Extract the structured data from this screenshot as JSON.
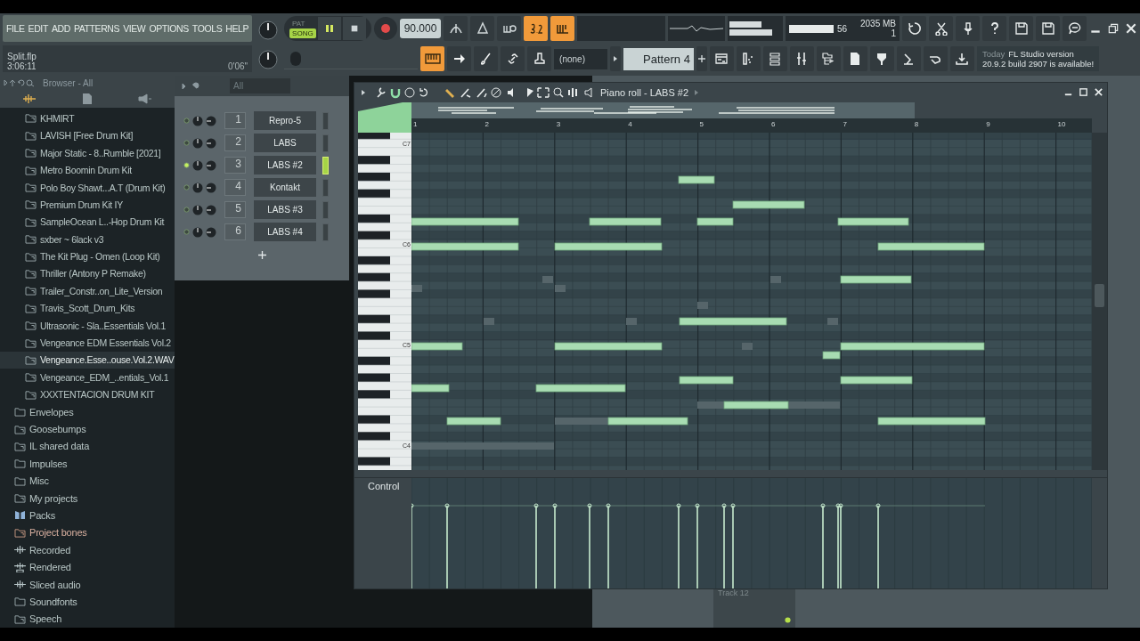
{
  "menu": [
    "FILE",
    "EDIT",
    "ADD",
    "PATTERNS",
    "VIEW",
    "OPTIONS",
    "TOOLS",
    "HELP"
  ],
  "project": {
    "file": "Split.flp",
    "time": "3:06:11",
    "elapsed": "0'06\""
  },
  "transport": {
    "modes": [
      {
        "label": "PAT",
        "selected": false
      },
      {
        "label": "SONG",
        "selected": true
      }
    ],
    "playing": true,
    "tempo": "90.000"
  },
  "toolbar_toggles": [
    {
      "kind": "metronome",
      "on": false
    },
    {
      "kind": "wait",
      "on": false
    },
    {
      "kind": "countdown",
      "on": true
    },
    {
      "kind": "loop",
      "on": true
    }
  ],
  "monitor": {
    "cpu": "56",
    "memory": "2035 MB",
    "voices": "1"
  },
  "typing_keyboard": {
    "on": true
  },
  "master_pitch": {
    "level": 0.05
  },
  "pattern": {
    "snap": "(none)",
    "name": "Pattern 4"
  },
  "news": {
    "date": "Today",
    "title": "FL Studio version",
    "text": "20.9.2 build 2907 is available!"
  },
  "browser": {
    "title": "Browser - All",
    "subfolder_items": [
      {
        "label": "KHMIRT",
        "kind": "linked",
        "selected": false
      },
      {
        "label": "LAVISH [Free Drum Kit]",
        "kind": "linked",
        "selected": false
      },
      {
        "label": "Major Static - 8..Rumble [2021]",
        "kind": "linked",
        "selected": false
      },
      {
        "label": "Metro Boomin Drum Kit",
        "kind": "linked",
        "selected": false
      },
      {
        "label": "Polo Boy Shawt...A.T (Drum Kit)",
        "kind": "linked",
        "selected": false
      },
      {
        "label": "Premium Drum Kit IY",
        "kind": "linked",
        "selected": false
      },
      {
        "label": "SampleOcean L..-Hop Drum Kit",
        "kind": "linked",
        "selected": false
      },
      {
        "label": "sxber ~ 6lack v3",
        "kind": "linked",
        "selected": false
      },
      {
        "label": "The Kit Plug - Omen (Loop Kit)",
        "kind": "linked",
        "selected": false
      },
      {
        "label": "Thriller (Antony P Remake)",
        "kind": "linked",
        "selected": false
      },
      {
        "label": "Trailer_Constr..on_Lite_Version",
        "kind": "linked",
        "selected": false
      },
      {
        "label": "Travis_Scott_Drum_Kits",
        "kind": "linked",
        "selected": false
      },
      {
        "label": "Ultrasonic - Sla..Essentials Vol.1",
        "kind": "linked",
        "selected": false
      },
      {
        "label": "Vengeance EDM Essentials Vol.2",
        "kind": "linked",
        "selected": false
      },
      {
        "label": "Vengeance.Esse..ouse.Vol.2.WAV",
        "kind": "linked",
        "selected": true
      },
      {
        "label": "Vengeance_EDM_..entials_Vol.1",
        "kind": "linked",
        "selected": false
      },
      {
        "label": "XXXTENTACION DRUM KIT",
        "kind": "linked",
        "selected": false
      }
    ],
    "items": [
      {
        "label": "Envelopes",
        "kind": "folder",
        "selected": false
      },
      {
        "label": "Goosebumps",
        "kind": "linked",
        "selected": false
      },
      {
        "label": "IL shared data",
        "kind": "linked",
        "selected": false
      },
      {
        "label": "Impulses",
        "kind": "folder",
        "selected": false
      },
      {
        "label": "Misc",
        "kind": "folder",
        "selected": false
      },
      {
        "label": "My projects",
        "kind": "linked",
        "selected": false
      },
      {
        "label": "Packs",
        "kind": "packs",
        "selected": false
      },
      {
        "label": "Project bones",
        "kind": "bones",
        "selected": false
      },
      {
        "label": "Recorded",
        "kind": "audio",
        "selected": false
      },
      {
        "label": "Rendered",
        "kind": "rendered",
        "selected": false
      },
      {
        "label": "Sliced audio",
        "kind": "audio",
        "selected": false
      },
      {
        "label": "Soundfonts",
        "kind": "folder",
        "selected": false
      },
      {
        "label": "Speech",
        "kind": "linked",
        "selected": false
      }
    ]
  },
  "channel_rack": {
    "filter": "All",
    "channels": [
      {
        "number": "1",
        "name": "Repro-5",
        "selected": false
      },
      {
        "number": "2",
        "name": "LABS",
        "selected": false
      },
      {
        "number": "3",
        "name": "LABS #2",
        "selected": true
      },
      {
        "number": "4",
        "name": "Kontakt",
        "selected": false
      },
      {
        "number": "5",
        "name": "LABS #3",
        "selected": false
      },
      {
        "number": "6",
        "name": "LABS #4",
        "selected": false
      }
    ]
  },
  "piano_roll": {
    "title": "Piano roll - LABS #2",
    "bars": [
      "1",
      "2",
      "3",
      "4",
      "5",
      "6",
      "7",
      "8",
      "9",
      "10"
    ],
    "keys": [
      "C7",
      "C6",
      "C5",
      "C4"
    ],
    "control_label": "Control"
  },
  "playlist": {
    "track": "Track 12"
  }
}
